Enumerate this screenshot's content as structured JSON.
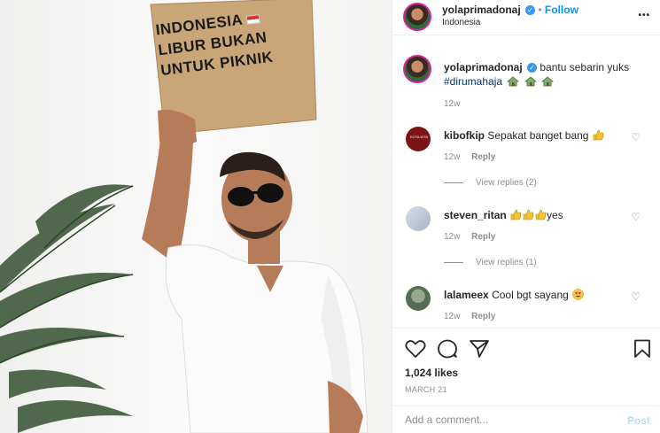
{
  "post": {
    "sign_lines": [
      "INDONESIA",
      "LIBUR BUKAN",
      "UNTUK PIKNIK"
    ]
  },
  "header": {
    "username": "yolaprimadonaj",
    "follow_label": "Follow",
    "separator": "•",
    "location": "Indonesia",
    "more_label": "•••"
  },
  "caption": {
    "username": "yolaprimadonaj",
    "text": "bantu sebarin yuks",
    "hashtag": "#dirumahaja",
    "time": "12w"
  },
  "comments": [
    {
      "username": "kibofkip",
      "text": "Sepakat banget bang",
      "time": "12w",
      "reply_label": "Reply",
      "view_replies": "View replies (2)",
      "avatar_text": "KOTA KITA"
    },
    {
      "username": "steven_ritan",
      "text": "yes",
      "time": "12w",
      "reply_label": "Reply",
      "view_replies": "View replies (1)"
    },
    {
      "username": "lalameex",
      "text": "Cool bgt sayang",
      "time": "12w",
      "reply_label": "Reply"
    }
  ],
  "actions": {
    "likes": "1,024 likes",
    "date": "MARCH 21"
  },
  "composer": {
    "placeholder": "Add a comment...",
    "post_label": "Post"
  },
  "icons": [
    "heart-icon",
    "comment-icon",
    "share-icon",
    "save-icon",
    "verified-icon",
    "house-emoji",
    "thumbs-up-emoji",
    "heart-eyes-emoji"
  ],
  "colors": {
    "accent": "#0095f6",
    "verified": "#3897f0",
    "text": "#262626",
    "muted": "#8e8e8e",
    "hashtag": "#00376b",
    "post_disabled": "#b2dffc"
  }
}
